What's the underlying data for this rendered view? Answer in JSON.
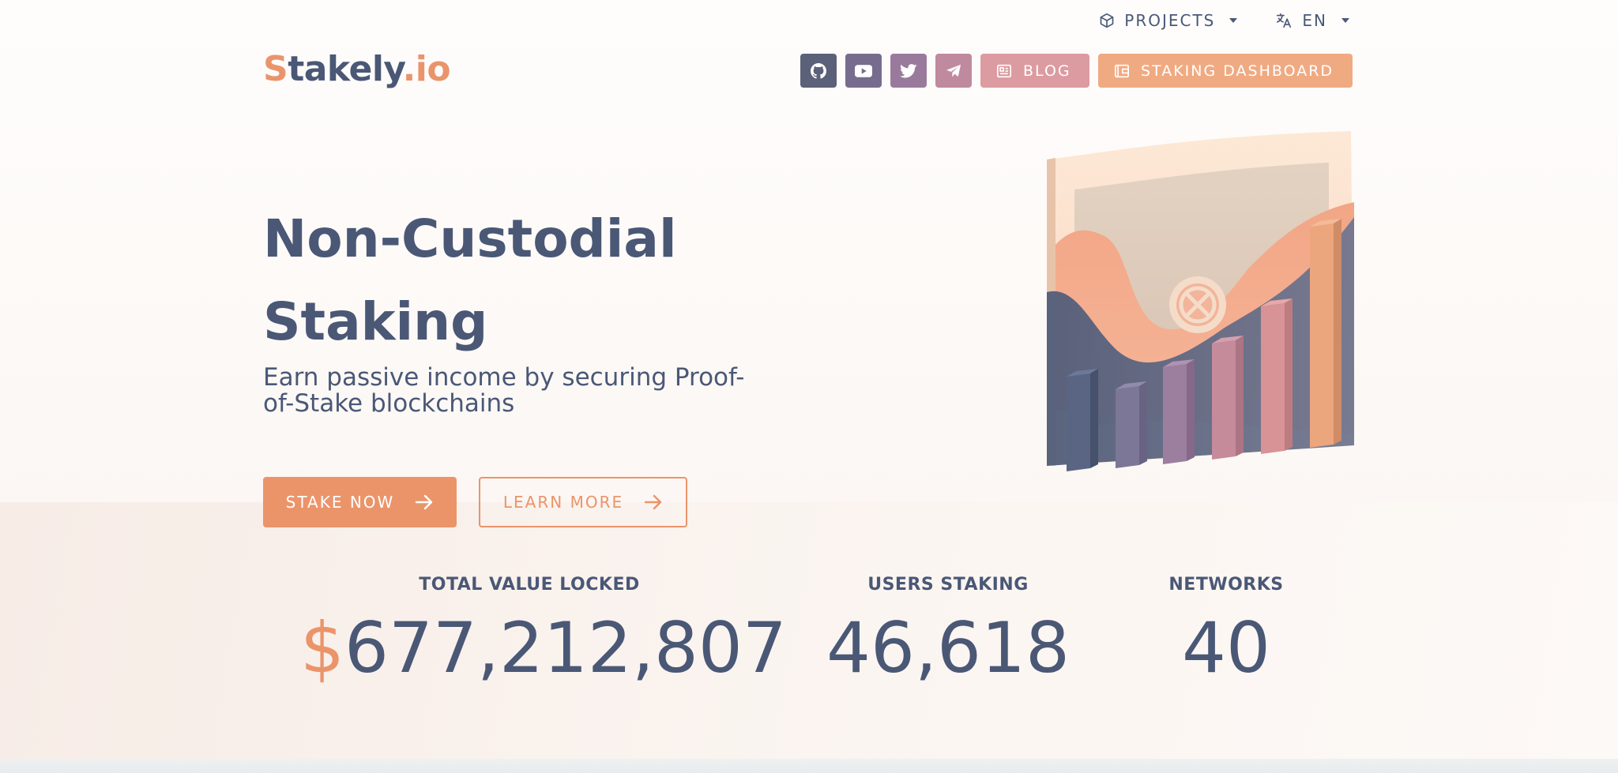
{
  "topbar": {
    "projects_label": "PROJECTS",
    "language_label": "EN"
  },
  "logo": {
    "s": "S",
    "rest": "takely",
    "dot": ".",
    "io": "io"
  },
  "nav": {
    "icons": [
      "github-icon",
      "youtube-icon",
      "twitter-icon",
      "telegram-icon"
    ],
    "blog_label": "BLOG",
    "dashboard_label": "STAKING DASHBOARD"
  },
  "hero": {
    "title": "Non-Custodial Staking",
    "subtitle": "Earn passive income by securing Proof-of-Stake blockchains",
    "stake_button": "STAKE NOW",
    "learn_button": "LEARN MORE"
  },
  "stats": {
    "tvl_label": "TOTAL VALUE LOCKED",
    "tvl_currency": "$",
    "tvl_value": "677,212,807",
    "users_label": "USERS STAKING",
    "users_value": "46,618",
    "networks_label": "NETWORKS",
    "networks_value": "40"
  },
  "colors": {
    "brand_orange": "#eb946a",
    "brand_navy": "#4a5876",
    "github_btn": "#5a6178",
    "youtube_btn": "#776c8d",
    "twitter_btn": "#9a7a9c",
    "telegram_btn": "#c08a9e",
    "blog_btn": "#dc9ba0",
    "dashboard_btn": "#f0aa82"
  }
}
